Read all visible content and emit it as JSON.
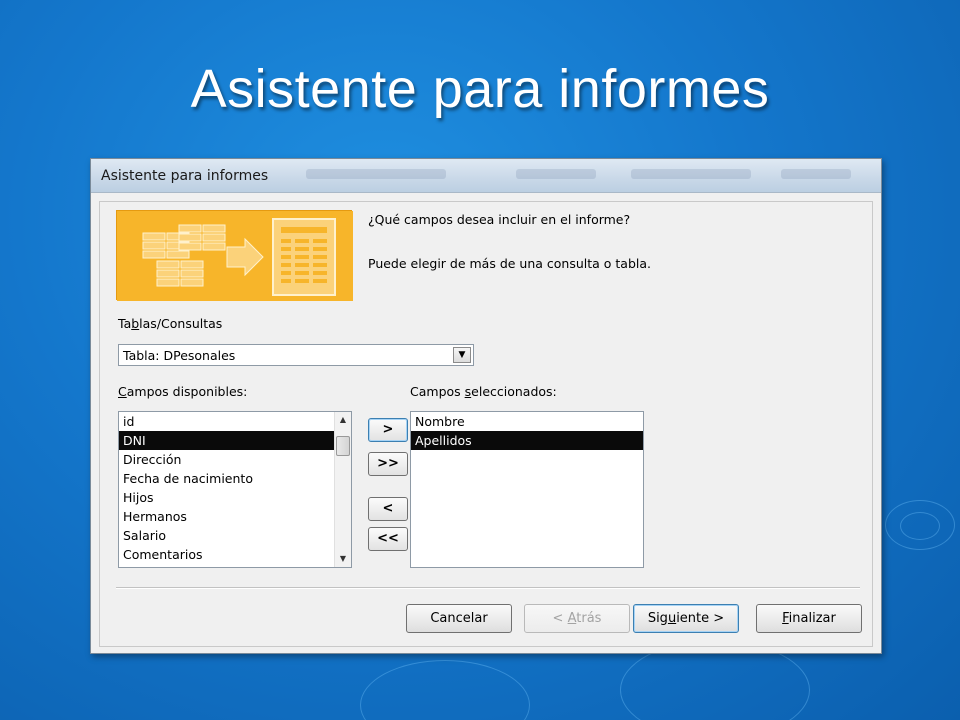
{
  "slide": {
    "title": "Asistente para informes"
  },
  "dialog": {
    "title": "Asistente para informes",
    "prompt_question": "¿Qué campos desea incluir en el informe?",
    "prompt_hint": "Puede elegir de más de una consulta o tabla.",
    "tables_label_pre": "Ta",
    "tables_label_key": "b",
    "tables_label_post": "las/Consultas",
    "table_selected": "Tabla: DPesonales",
    "available_label_key": "C",
    "available_label_post": "ampos disponibles:",
    "selected_label_pre": "Campos ",
    "selected_label_key": "s",
    "selected_label_post": "eleccionados:",
    "available_fields": [
      {
        "label": "id"
      },
      {
        "label": "DNI"
      },
      {
        "label": "Dirección"
      },
      {
        "label": "Fecha de nacimiento"
      },
      {
        "label": "Hijos"
      },
      {
        "label": "Hermanos"
      },
      {
        "label": "Salario"
      },
      {
        "label": "Comentarios"
      }
    ],
    "available_selected_index": 1,
    "selected_fields": [
      {
        "label": "Nombre"
      },
      {
        "label": "Apellidos"
      }
    ],
    "selected_selected_index": 1,
    "move_buttons": {
      "add_one": ">",
      "add_all": ">>",
      "remove_one": "<",
      "remove_all": "<<"
    },
    "buttons": {
      "cancel": "Cancelar",
      "back_pre": "< ",
      "back_key": "A",
      "back_post": "trás",
      "next_pre": "Sig",
      "next_key": "u",
      "next_post": "iente >",
      "finish_key": "F",
      "finish_post": "inalizar"
    }
  },
  "colors": {
    "background": "#1477cc",
    "wizard_art": "#f7b52a",
    "selection": "#0a0a0a"
  }
}
